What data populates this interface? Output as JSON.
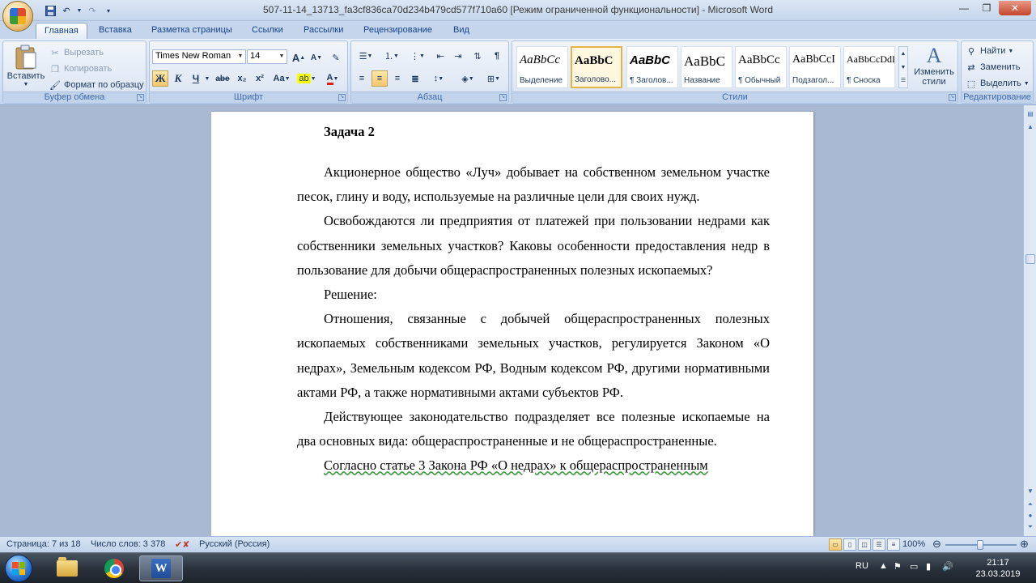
{
  "titlebar": {
    "title": "507-11-14_13713_fa3cf836ca70d234b479cd577f710a60 [Режим ограниченной функциональности] - Microsoft Word"
  },
  "tabs": [
    "Главная",
    "Вставка",
    "Разметка страницы",
    "Ссылки",
    "Рассылки",
    "Рецензирование",
    "Вид"
  ],
  "ribbon": {
    "clipboard": {
      "paste": "Вставить",
      "cut": "Вырезать",
      "copy": "Копировать",
      "format_painter": "Формат по образцу",
      "label": "Буфер обмена"
    },
    "font": {
      "font_name": "Times New Roman",
      "font_size": "14",
      "label": "Шрифт",
      "bold": "Ж",
      "italic": "К",
      "underline": "Ч",
      "strike": "abe",
      "subscript": "x₂",
      "superscript": "x²",
      "case": "Aa",
      "grow": "A",
      "shrink": "A"
    },
    "paragraph": {
      "label": "Абзац"
    },
    "styles": {
      "label": "Стили",
      "items": [
        {
          "sample": "AaBbCc",
          "name": "Выделение"
        },
        {
          "sample": "AaBbC",
          "name": "Заголово..."
        },
        {
          "sample": "AaBbC",
          "name": "¶ Заголов..."
        },
        {
          "sample": "AaBbC",
          "name": "Название"
        },
        {
          "sample": "AaBbCc",
          "name": "¶ Обычный"
        },
        {
          "sample": "AaBbCcI",
          "name": "Подзагол..."
        },
        {
          "sample": "AaBbCcDdI",
          "name": "¶ Сноска"
        }
      ],
      "change_styles": "Изменить стили"
    },
    "editing": {
      "label": "Редактирование",
      "find": "Найти",
      "replace": "Заменить",
      "select": "Выделить"
    }
  },
  "document": {
    "heading": "Задача 2",
    "paragraphs": [
      "Акционерное общество «Луч» добывает на собственном земельном участке песок, глину и воду, используемые на различные цели для своих нужд.",
      "Освобождаются ли предприятия от платежей при пользовании недрами как собственники земельных участков? Каковы особенности предоставления недр в пользование для добычи общераспространенных полезных ископаемых?",
      "Решение:",
      "Отношения, связанные с добычей общераспространенных полезных ископаемых собственниками земельных участков, регулируется Законом «О недрах», Земельным кодексом РФ, Водным кодексом РФ, другими нормативными актами РФ, а также нормативными актами субъектов РФ.",
      "Действующее законодательство подразделяет все полезные ископаемые на два основных вида: общераспространенные и не общераспространенные.",
      "Согласно статье 3 Закона РФ «О недрах» к общераспространенным"
    ]
  },
  "statusbar": {
    "page": "Страница: 7 из 18",
    "words": "Число слов: 3 378",
    "language": "Русский (Россия)",
    "zoom": "100%"
  },
  "taskbar": {
    "lang": "RU",
    "time": "21:17",
    "date": "23.03.2019"
  }
}
